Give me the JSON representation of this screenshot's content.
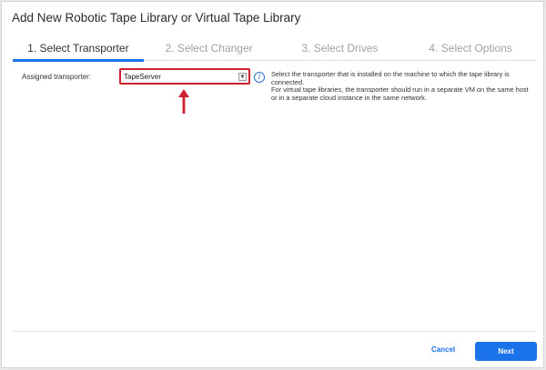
{
  "dialog": {
    "title": "Add New Robotic Tape Library or Virtual Tape Library"
  },
  "steps": [
    {
      "label": "1. Select Transporter",
      "active": true
    },
    {
      "label": "2. Select Changer",
      "active": false
    },
    {
      "label": "3. Select Drives",
      "active": false
    },
    {
      "label": "4. Select Options",
      "active": false
    }
  ],
  "transporter": {
    "label": "Assigned transporter:",
    "value": "TapeServer"
  },
  "help": {
    "line1": "Select the transporter that is installed on the machine to which the tape library is connected.",
    "line2": "For virtual tape libraries, the transporter should run in a separate VM on the same host or in a separate cloud instance in the same network."
  },
  "footer": {
    "cancel_label": "Cancel",
    "next_label": "Next"
  },
  "colors": {
    "accent": "#1a73e8",
    "highlight": "#cf1f2e"
  },
  "icons": {
    "info": "info-icon",
    "dropdown": "chevron-down-icon",
    "annotation": "arrow-up-icon"
  }
}
